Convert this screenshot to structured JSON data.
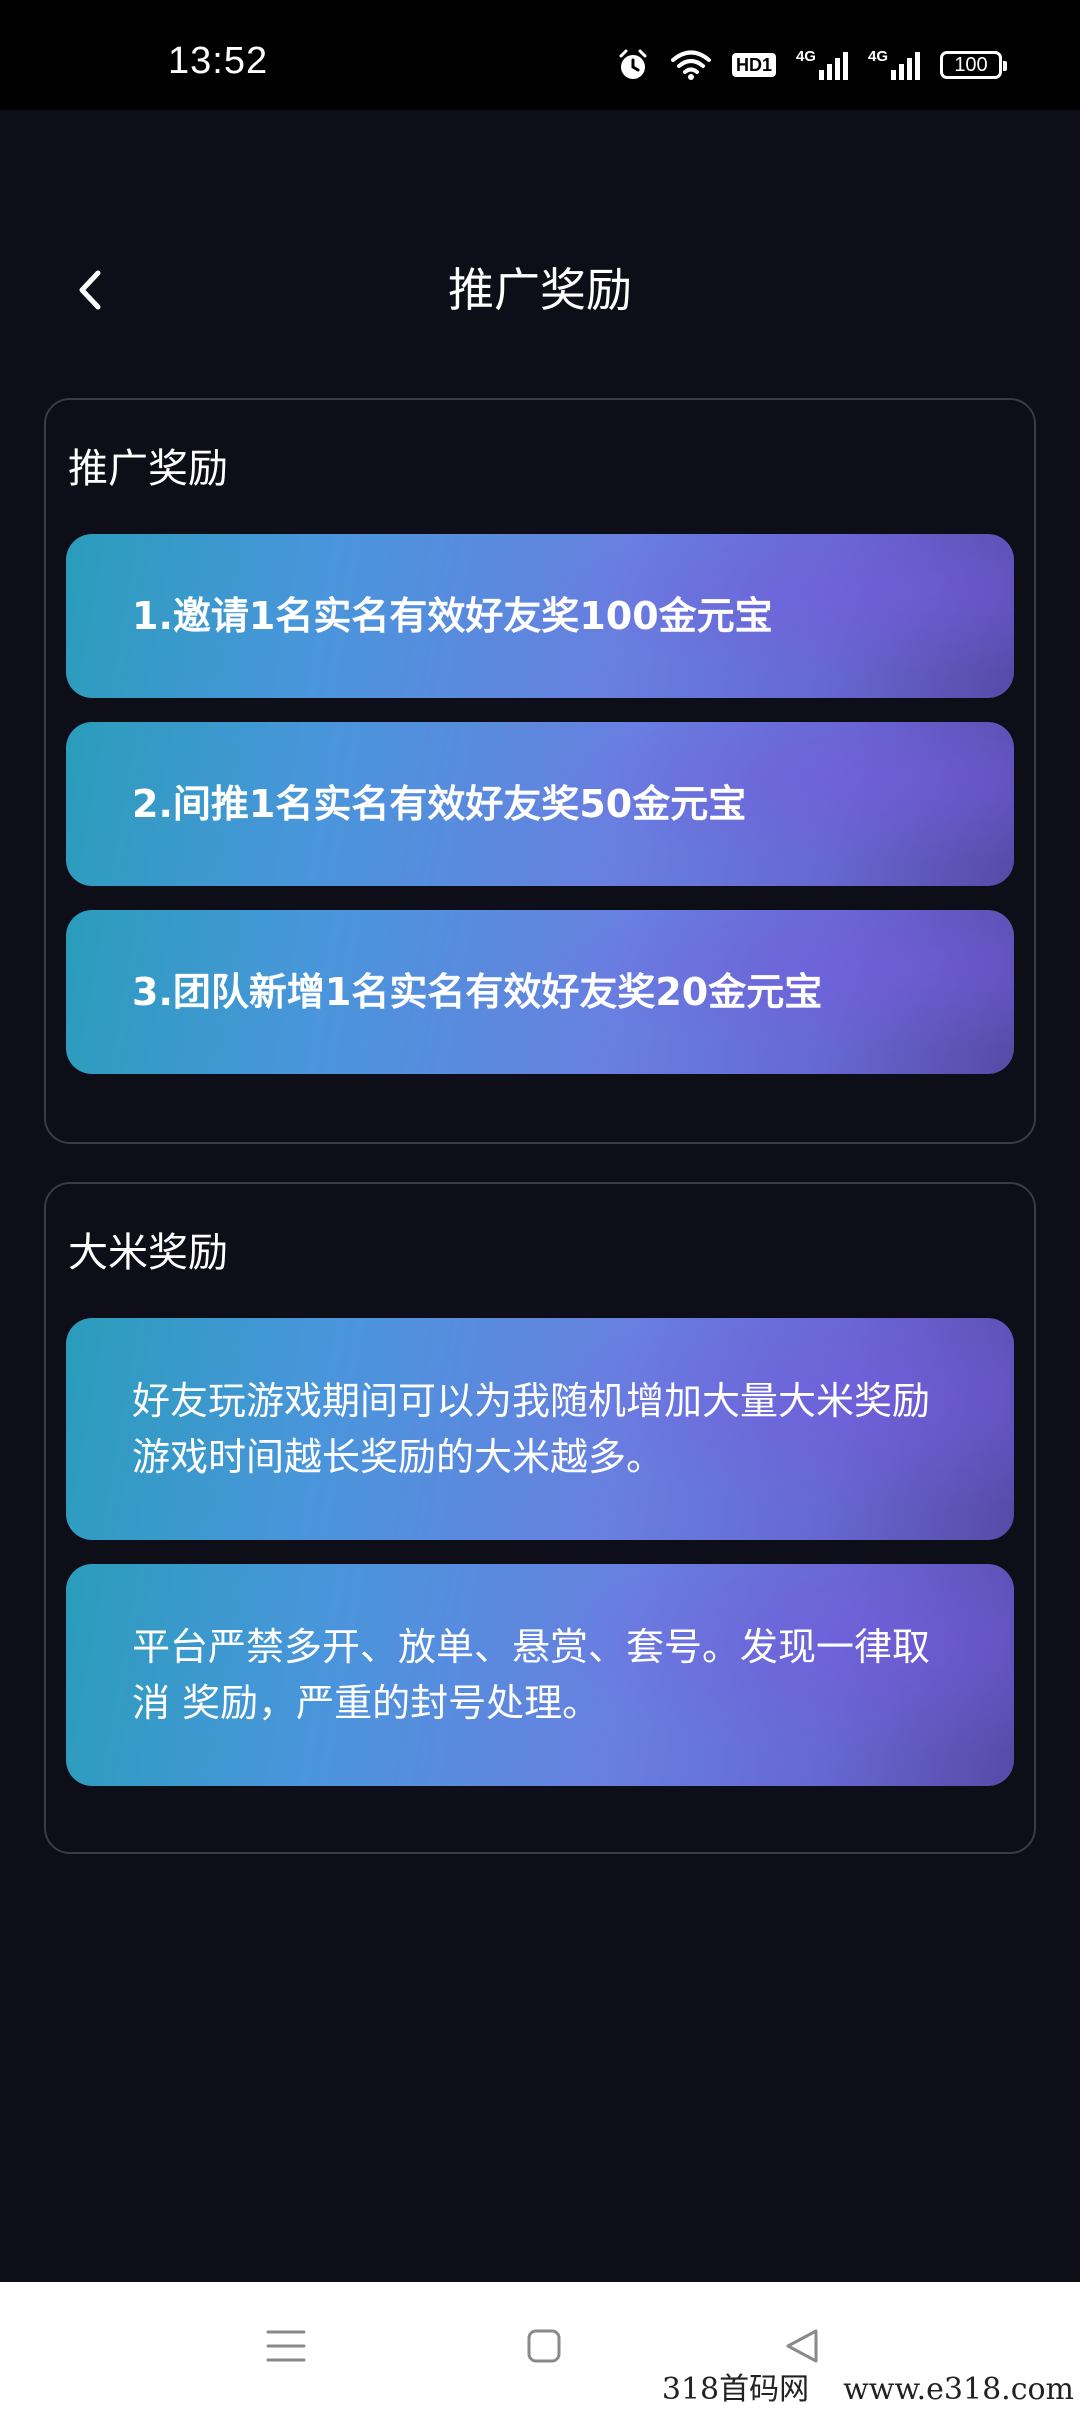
{
  "status_bar": {
    "time": "13:52",
    "network_badge": "HD1",
    "signal_1": "4G",
    "signal_2": "4G",
    "battery": "100"
  },
  "header": {
    "title": "推广奖励"
  },
  "promotion": {
    "heading": "推广奖励",
    "items": [
      "1.邀请1名实名有效好友奖100金元宝",
      "2.间推1名实名有效好友奖50金元宝",
      "3.团队新增1名实名有效好友奖20金元宝"
    ]
  },
  "rice": {
    "heading": "大米奖励",
    "items": [
      "好友玩游戏期间可以为我随机增加大量大米奖励 游戏时间越长奖励的大米越多。",
      "平台严禁多开、放单、悬赏、套号。发现一律取消 奖励，严重的封号处理。"
    ]
  },
  "watermark": {
    "left": "318首码网",
    "right": "www.e318.com"
  },
  "colors": {
    "background": "#0e0e18",
    "card_gradient_start": "#2a9dbb",
    "card_gradient_end": "#574aa6",
    "panel_border": "#3a3a48"
  }
}
